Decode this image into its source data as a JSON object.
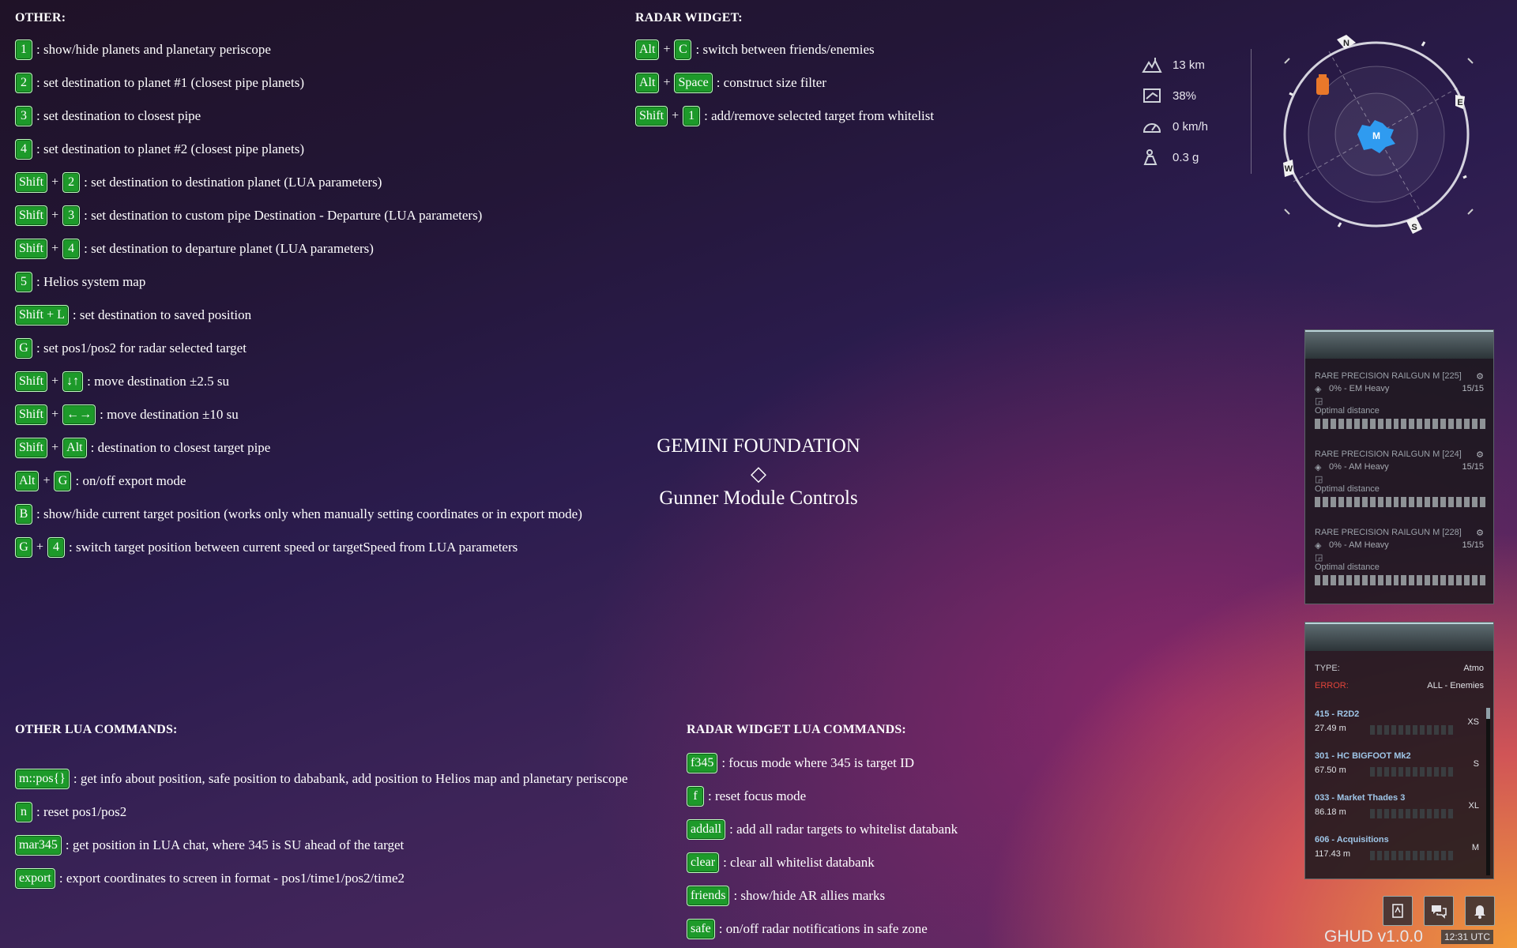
{
  "other": {
    "title": "OTHER:",
    "rows": [
      {
        "keys": [
          "1"
        ],
        "desc": ": show/hide planets and planetary periscope"
      },
      {
        "keys": [
          "2"
        ],
        "desc": ": set destination to planet #1 (closest pipe planets)"
      },
      {
        "keys": [
          "3"
        ],
        "desc": ": set destination to closest pipe"
      },
      {
        "keys": [
          "4"
        ],
        "desc": ": set destination to planet #2 (closest pipe planets)"
      },
      {
        "keys": [
          "Shift",
          "2"
        ],
        "desc": ": set destination to destination planet (LUA parameters)"
      },
      {
        "keys": [
          "Shift",
          "3"
        ],
        "desc": ": set destination to custom pipe Destination - Departure (LUA parameters)"
      },
      {
        "keys": [
          "Shift",
          "4"
        ],
        "desc": ": set destination to departure planet (LUA parameters)"
      },
      {
        "keys": [
          "5"
        ],
        "desc": ": Helios system map"
      },
      {
        "keys": [
          "Shift + L"
        ],
        "desc": ": set destination to saved position"
      },
      {
        "keys": [
          "G"
        ],
        "desc": ": set pos1/pos2 for radar selected target"
      },
      {
        "keys": [
          "Shift",
          "↓↑"
        ],
        "desc": ": move destination ±2.5 su"
      },
      {
        "keys": [
          "Shift",
          "←→"
        ],
        "desc": ": move destination ±10 su"
      },
      {
        "keys": [
          "Shift",
          "Alt"
        ],
        "desc": ": destination to closest target pipe"
      },
      {
        "keys": [
          "Alt",
          "G"
        ],
        "desc": ": on/off export mode"
      },
      {
        "keys": [
          "B"
        ],
        "desc": ": show/hide current target position (works only when manually setting coordinates or in export mode)"
      },
      {
        "keys": [
          "G",
          "4"
        ],
        "desc": ": switch target position between current speed or targetSpeed from LUA parameters"
      }
    ]
  },
  "radar_widget": {
    "title": "RADAR WIDGET:",
    "rows": [
      {
        "keys": [
          "Alt",
          "C"
        ],
        "desc": ": switch between friends/enemies"
      },
      {
        "keys": [
          "Alt",
          "Space"
        ],
        "desc": ": construct size filter"
      },
      {
        "keys": [
          "Shift",
          "1"
        ],
        "desc": ": add/remove selected target from whitelist"
      }
    ]
  },
  "center": {
    "line1": "GEMINI FOUNDATION",
    "separator": "◇",
    "line2": "Gunner Module Controls"
  },
  "other_lua": {
    "title": "OTHER LUA COMMANDS:",
    "rows": [
      {
        "keys": [
          "m::pos{}"
        ],
        "desc": ": get info about position, safe position to dababank, add position to Helios map and planetary periscope"
      },
      {
        "keys": [
          "n"
        ],
        "desc": ": reset pos1/pos2"
      },
      {
        "keys": [
          "mar345"
        ],
        "desc": ": get position in LUA chat, where 345 is SU ahead of the target"
      },
      {
        "keys": [
          "export"
        ],
        "desc": ": export coordinates to screen in format - pos1/time1/pos2/time2"
      }
    ]
  },
  "radar_lua": {
    "title": "RADAR WIDGET LUA COMMANDS:",
    "rows": [
      {
        "keys": [
          "f345"
        ],
        "desc": ": focus mode where 345 is target ID"
      },
      {
        "keys": [
          "f"
        ],
        "desc": ": reset focus mode"
      },
      {
        "keys": [
          "addall"
        ],
        "desc": ": add all radar targets to whitelist databank"
      },
      {
        "keys": [
          "clear"
        ],
        "desc": ": clear all whitelist databank"
      },
      {
        "keys": [
          "friends"
        ],
        "desc": ": show/hide AR allies marks"
      },
      {
        "keys": [
          "safe"
        ],
        "desc": ": on/off radar notifications in safe zone"
      }
    ]
  },
  "hud": {
    "altitude": "13 km",
    "throttle": "38%",
    "speed": "0 km/h",
    "gravity": "0.3 g",
    "compass": {
      "n": "N",
      "e": "E",
      "s": "S",
      "w": "W",
      "center": "M"
    }
  },
  "weapons": [
    {
      "name": "RARE PRECISION RAILGUN M [225]",
      "ammo": "0% - EM Heavy",
      "count": "15/15",
      "optimal": "Optimal distance"
    },
    {
      "name": "RARE PRECISION RAILGUN M [224]",
      "ammo": "0% - AM Heavy",
      "count": "15/15",
      "optimal": "Optimal distance"
    },
    {
      "name": "RARE PRECISION RAILGUN M [228]",
      "ammo": "0% - AM Heavy",
      "count": "15/15",
      "optimal": "Optimal distance"
    }
  ],
  "radar_panel": {
    "type_label": "TYPE:",
    "type_value": "Atmo",
    "error_label": "ERROR:",
    "filter_value": "ALL - Enemies",
    "error_color": "#e0443a",
    "targets": [
      {
        "name": "415 - R2D2",
        "dist": "27.49 m",
        "size": "XS"
      },
      {
        "name": "301 - HC BIGFOOT Mk2",
        "dist": "67.50 m",
        "size": "S"
      },
      {
        "name": "033 - Market Thades 3",
        "dist": "86.18 m",
        "size": "XL"
      },
      {
        "name": "606 - Acquisitions",
        "dist": "117.43 m",
        "size": "M"
      }
    ]
  },
  "footer": {
    "version": "GHUD v1.0.0",
    "time": "12:31 UTC",
    "buttons": [
      "book-icon",
      "chat-icon",
      "bell-icon"
    ]
  },
  "colors": {
    "key_green": "#1d9a2a",
    "accent_blue": "#2f9bf0",
    "marker_orange": "#e9782a"
  }
}
